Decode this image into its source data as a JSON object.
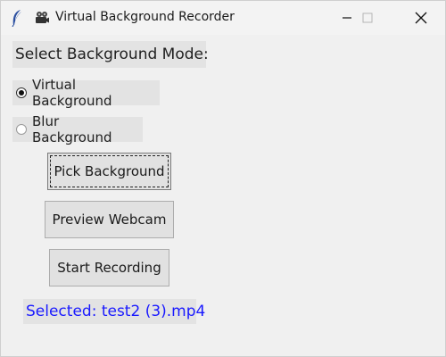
{
  "window": {
    "title": "Virtual Background Recorder",
    "title_icons": [
      "feather-icon",
      "video-camera-icon"
    ],
    "controls": [
      "minimize-icon",
      "maximize-icon",
      "close-icon"
    ]
  },
  "mode": {
    "heading": "Select Background Mode:",
    "options": [
      {
        "label": "Virtual Background",
        "selected": true
      },
      {
        "label": "Blur Background",
        "selected": false
      }
    ]
  },
  "buttons": {
    "pick": "Pick Background",
    "preview": "Preview Webcam",
    "start": "Start Recording"
  },
  "status": {
    "text": "Selected: test2 (3).mp4",
    "color": "#1a1aff"
  },
  "colors": {
    "window_bg": "#f0f0f0",
    "label_bg": "#e3e3e3",
    "button_bg": "#e1e1e1"
  }
}
